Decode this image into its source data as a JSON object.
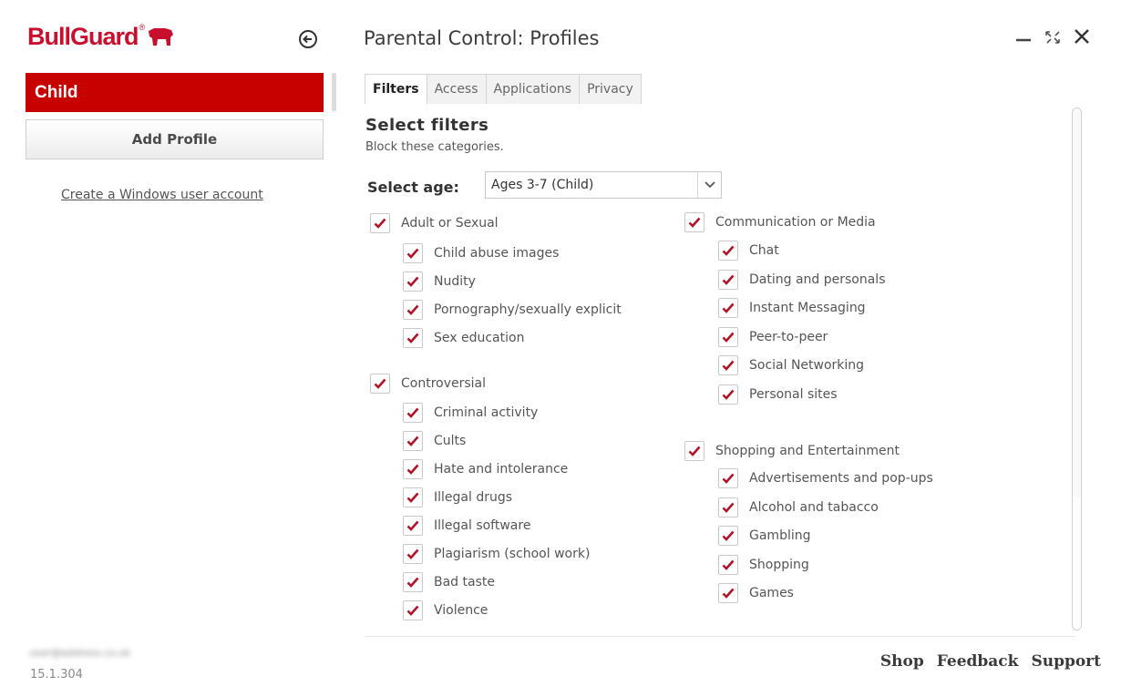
{
  "app": {
    "brand": "BullGuard",
    "registered_mark": "®",
    "title": "Parental Control: Profiles",
    "version": "15.1.304",
    "account_email": "user@address.co.uk"
  },
  "colors": {
    "brand_red": "#c8102e",
    "active_profile_bg": "#c70000",
    "checkmark": "#b01426"
  },
  "sidebar": {
    "active_profile": "Child",
    "add_profile": "Add Profile",
    "create_account_link": "Create a Windows user account"
  },
  "tabs": [
    {
      "label": "Filters",
      "active": true
    },
    {
      "label": "Access",
      "active": false
    },
    {
      "label": "Applications",
      "active": false
    },
    {
      "label": "Privacy",
      "active": false
    }
  ],
  "filters": {
    "heading": "Select filters",
    "subheading": "Block these categories.",
    "age_label": "Select age:",
    "age_value": "Ages 3-7 (Child)",
    "groups": {
      "adult": {
        "label": "Adult or Sexual",
        "checked": true,
        "items": [
          "Child abuse images",
          "Nudity",
          "Pornography/sexually explicit",
          "Sex education"
        ]
      },
      "controversial": {
        "label": "Controversial",
        "checked": true,
        "items": [
          "Criminal activity",
          "Cults",
          "Hate and intolerance",
          "Illegal drugs",
          "Illegal software",
          "Plagiarism (school work)",
          "Bad taste",
          "Violence"
        ]
      },
      "communication": {
        "label": "Communication or Media",
        "checked": true,
        "items": [
          "Chat",
          "Dating and personals",
          "Instant Messaging",
          "Peer-to-peer",
          "Social Networking",
          "Personal sites"
        ]
      },
      "shopping": {
        "label": "Shopping and Entertainment",
        "checked": true,
        "items": [
          "Advertisements and pop-ups",
          "Alcohol and tabacco",
          "Gambling",
          "Shopping",
          "Games"
        ]
      }
    }
  },
  "footer": {
    "shop": "Shop",
    "feedback": "Feedback",
    "support": "Support"
  },
  "icons": {
    "back": "back-arrow-circle-icon",
    "minimize": "minimize-icon",
    "restore": "restore-icon",
    "close": "close-icon",
    "dropdown": "chevron-down-icon",
    "check": "checkmark-icon"
  }
}
